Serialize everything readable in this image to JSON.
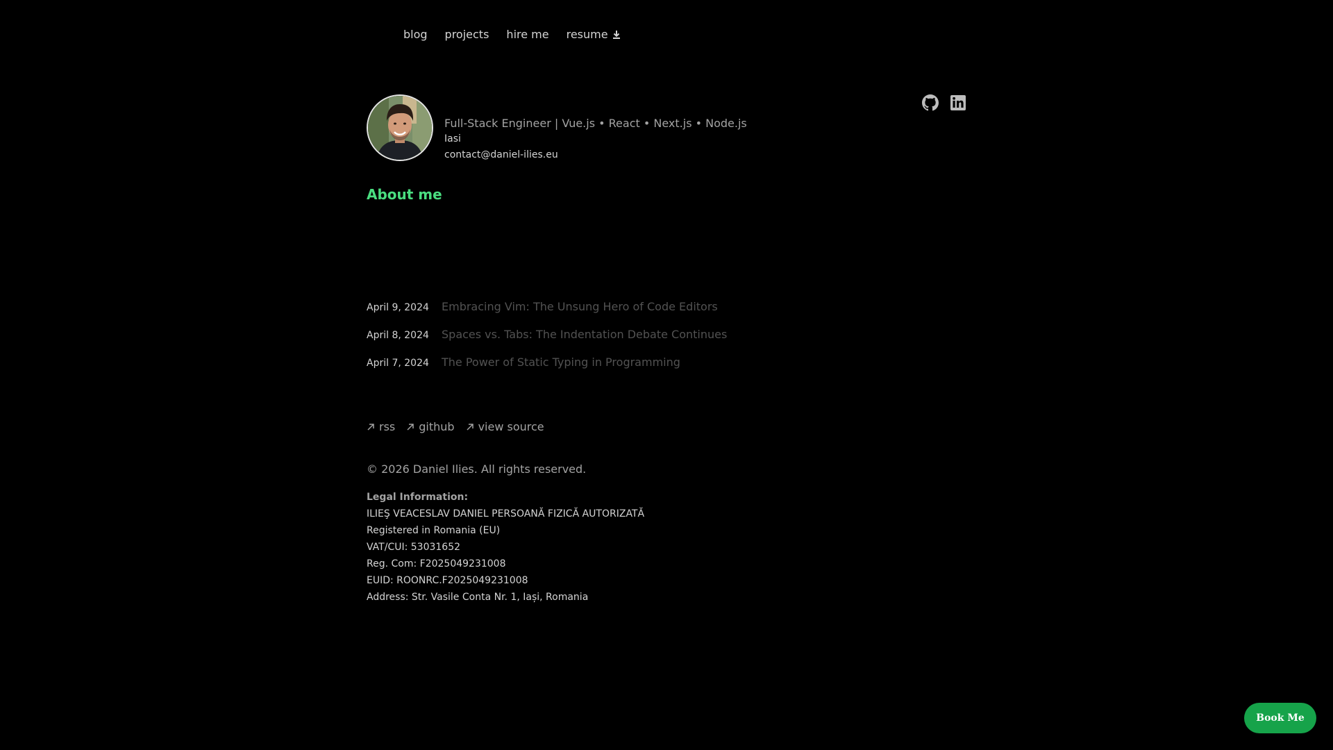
{
  "nav": {
    "items": [
      {
        "label": "blog"
      },
      {
        "label": "projects"
      },
      {
        "label": "hire me"
      },
      {
        "label": "resume",
        "icon": "download-icon"
      }
    ]
  },
  "social": {
    "items": [
      {
        "icon": "github-icon"
      },
      {
        "icon": "linkedin-icon"
      }
    ]
  },
  "profile": {
    "avatar_icon": "avatar",
    "headline": "Full-Stack Engineer | Vue.js • React • Next.js • Node.js",
    "location": "Iasi",
    "email": "contact@daniel-ilies.eu"
  },
  "about": {
    "title": "About me"
  },
  "posts": [
    {
      "date": "April 9, 2024",
      "title": "Embracing Vim: The Unsung Hero of Code Editors"
    },
    {
      "date": "April 8, 2024",
      "title": "Spaces vs. Tabs: The Indentation Debate Continues"
    },
    {
      "date": "April 7, 2024",
      "title": "The Power of Static Typing in Programming"
    }
  ],
  "footer": {
    "links": [
      {
        "label": "rss",
        "icon": "arrow-up-right-icon"
      },
      {
        "label": "github",
        "icon": "arrow-up-right-icon"
      },
      {
        "label": "view source",
        "icon": "arrow-up-right-icon"
      }
    ],
    "copyright": "© 2026 Daniel Ilies. All rights reserved."
  },
  "legal": {
    "heading": "Legal Information:",
    "name": "ILIEŞ VEACESLAV DANIEL PERSOANĂ FIZICĂ AUTORIZATĂ",
    "registered": "Registered in Romania (EU)",
    "vat": "VAT/CUI: 53031652",
    "reg_com": "Reg. Com: F2025049231008",
    "euid": "EUID: ROONRC.F2025049231008",
    "address": "Address: Str. Vasile Conta Nr. 1, Iași, Romania"
  },
  "cta": {
    "label": "Book Me"
  },
  "colors": {
    "background": "#000000",
    "accent": "#4ade80",
    "button": "#16a34a"
  }
}
